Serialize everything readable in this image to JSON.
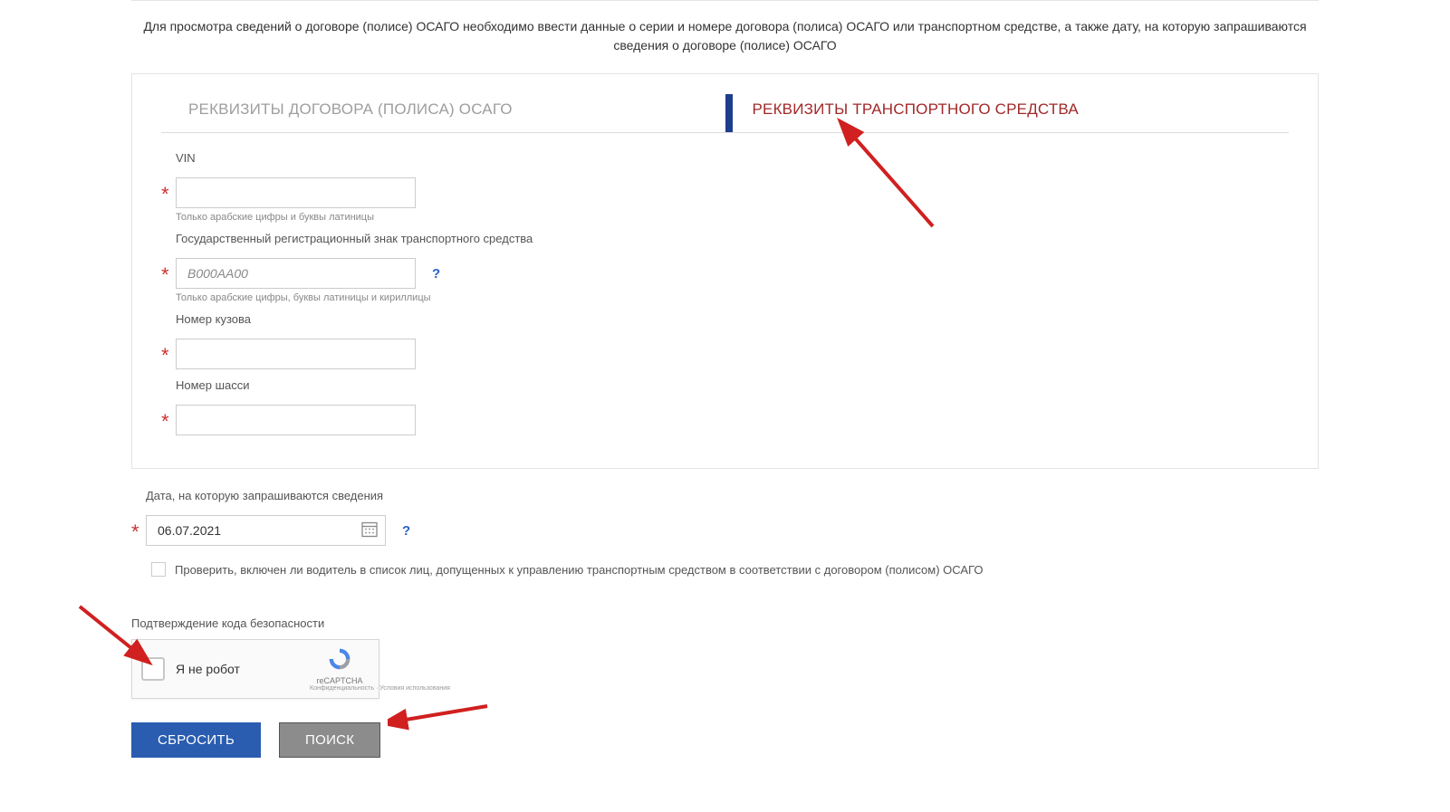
{
  "intro": "Для просмотра сведений о договоре (полисе) ОСАГО необходимо ввести данные о серии и номере договора (полиса) ОСАГО или транспортном средстве, а также дату, на которую запрашиваются сведения о договоре (полисе) ОСАГО",
  "tabs": {
    "policy": "РЕКВИЗИТЫ ДОГОВОРА (ПОЛИСА) ОСАГО",
    "vehicle": "РЕКВИЗИТЫ ТРАНСПОРТНОГО СРЕДСТВА"
  },
  "form": {
    "vin": {
      "label": "VIN",
      "value": "",
      "hint": "Только арабские цифры и буквы латиницы"
    },
    "plate": {
      "label": "Государственный регистрационный знак транспортного средства",
      "placeholder": "В000АА00",
      "value": "",
      "hint": "Только арабские цифры, буквы латиницы и кириллицы"
    },
    "body": {
      "label": "Номер кузова",
      "value": ""
    },
    "chassis": {
      "label": "Номер шасси",
      "value": ""
    },
    "date": {
      "label": "Дата, на которую запрашиваются сведения",
      "value": "06.07.2021"
    },
    "check_driver": "Проверить, включен ли водитель в список лиц, допущенных к управлению транспортным средством в соответствии с договором (полисом) ОСАГО",
    "asterisk": "*",
    "help": "?"
  },
  "captcha": {
    "heading": "Подтверждение кода безопасности",
    "label": "Я не робот",
    "brand": "reCAPTCHA",
    "links": "Конфиденциальность · Условия использования"
  },
  "buttons": {
    "reset": "СБРОСИТЬ",
    "search": "ПОИСК"
  }
}
